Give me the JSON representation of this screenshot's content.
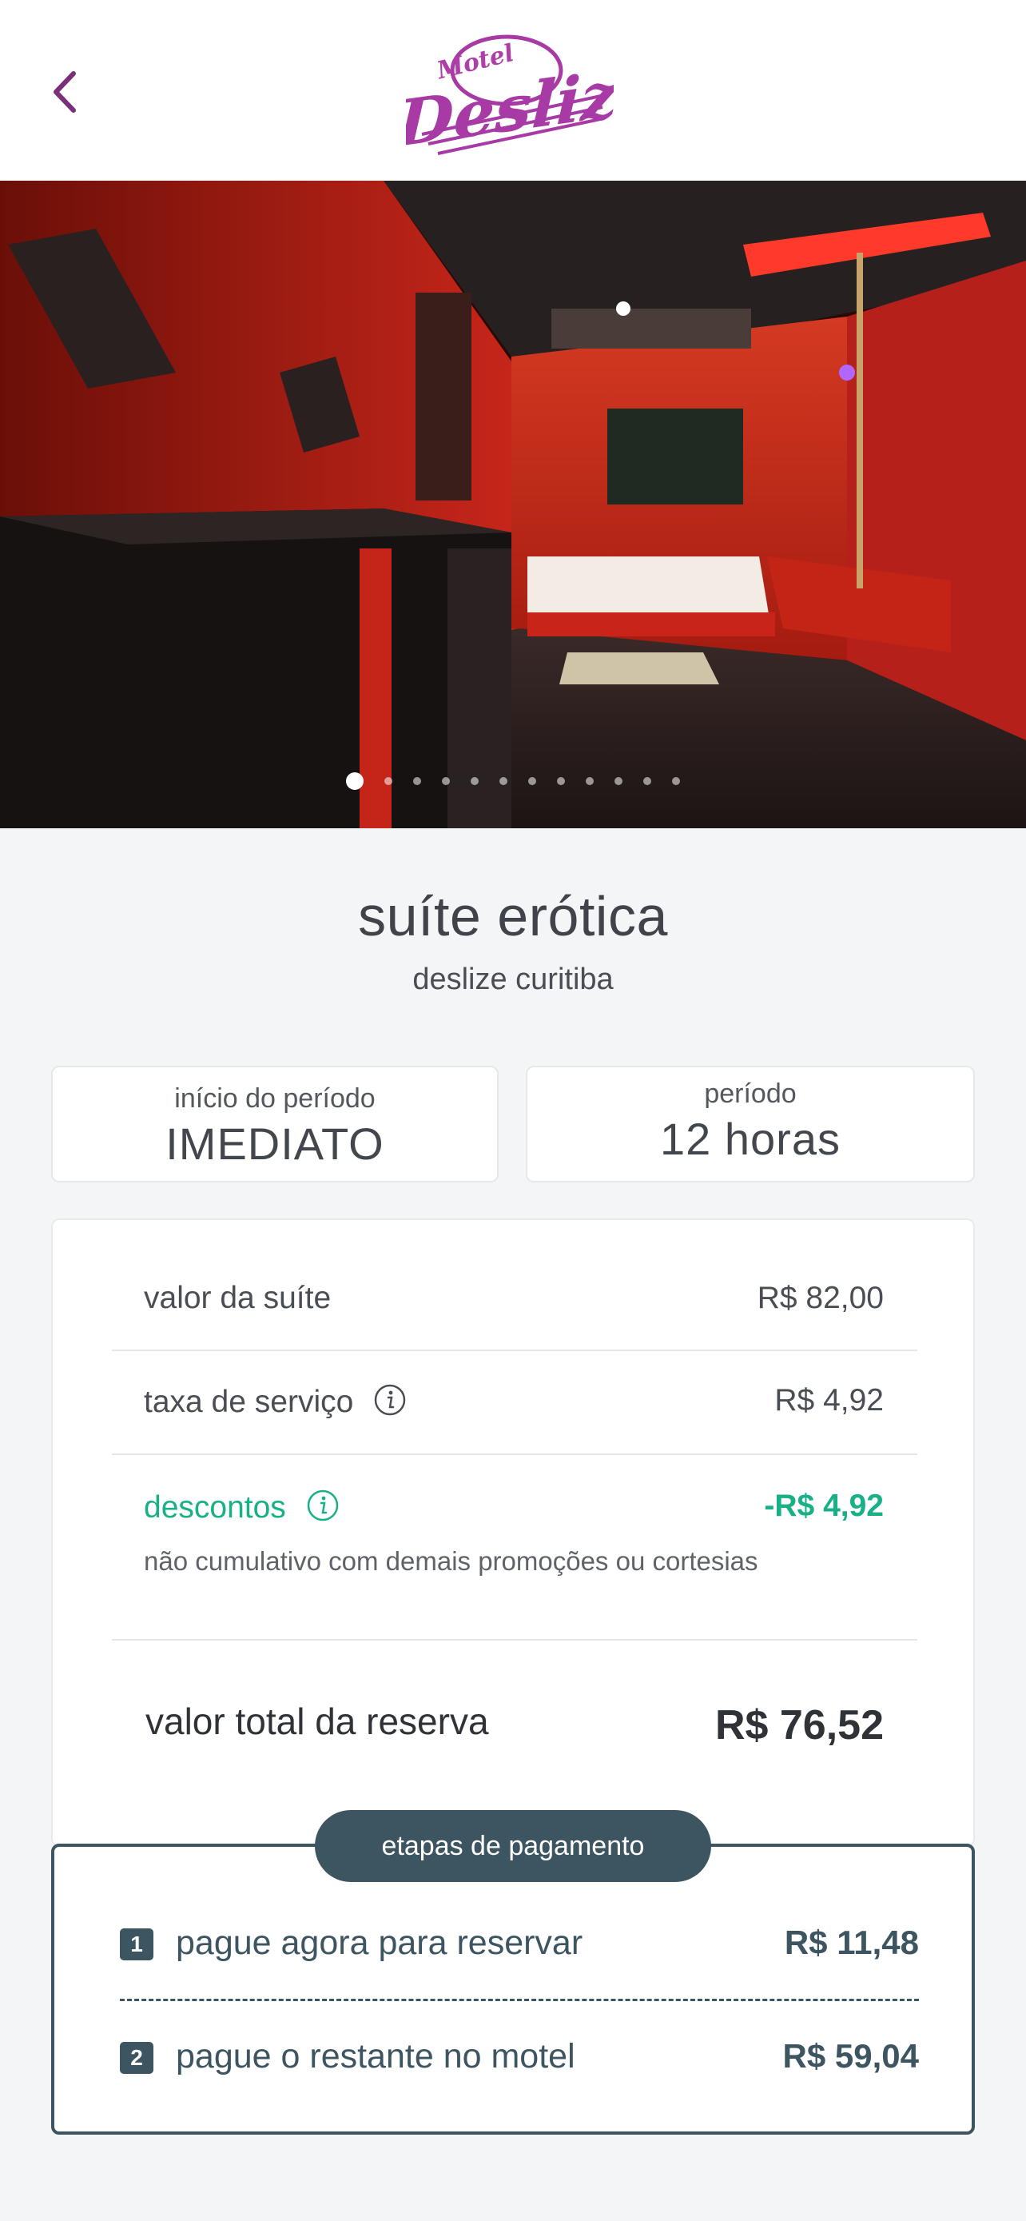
{
  "header": {
    "back_icon": "chevron-left-icon",
    "logo": {
      "small": "Motel",
      "big": "Deslize"
    }
  },
  "gallery": {
    "photo_count": 12,
    "active_index": 0
  },
  "suite": {
    "title": "suíte erótica",
    "location": "deslize curitiba"
  },
  "period": {
    "start_label": "início do período",
    "start_value": "IMEDIATO",
    "duration_label": "período",
    "duration_value": "12 horas"
  },
  "pricing": {
    "suite_label": "valor da suíte",
    "suite_value": "R$ 82,00",
    "fee_label": "taxa de serviço",
    "fee_value": "R$ 4,92",
    "discount_label": "descontos",
    "discount_value": "-R$ 4,92",
    "discount_note": "não cumulativo com demais promoções ou cortesias",
    "total_label": "valor total da reserva",
    "total_value": "R$ 76,52"
  },
  "payment": {
    "title": "etapas de pagamento",
    "steps": [
      {
        "num": "1",
        "label": "pague agora para reservar",
        "value": "R$ 11,48"
      },
      {
        "num": "2",
        "label": "pague o restante no motel",
        "value": "R$ 59,04"
      }
    ]
  },
  "colors": {
    "brand": "#a73aa5",
    "discount": "#18b086",
    "payment": "#3d5560"
  }
}
